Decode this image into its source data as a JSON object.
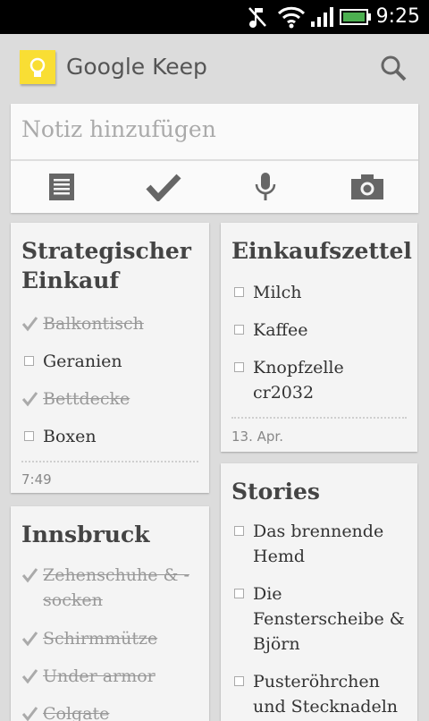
{
  "status": {
    "time": "9:25"
  },
  "app": {
    "title": "Google Keep"
  },
  "add_note": {
    "placeholder": "Notiz hinzufügen"
  },
  "notes": {
    "strategic": {
      "title_line1": "Strategischer",
      "title_line2": "Einkauf",
      "items": [
        {
          "text": "Balkontisch",
          "done": true
        },
        {
          "text": "Geranien",
          "done": false
        },
        {
          "text": "Bettdecke",
          "done": true
        },
        {
          "text": "Boxen",
          "done": false
        }
      ],
      "date": "7:49"
    },
    "shopping": {
      "title": "Einkaufszettel",
      "items": [
        {
          "text": "Milch",
          "done": false
        },
        {
          "text": "Kaffee",
          "done": false
        },
        {
          "text_line1": "Knopfzelle",
          "text_line2": "cr2032",
          "done": false
        }
      ],
      "date": "13. Apr."
    },
    "innsbruck": {
      "title": "Innsbruck",
      "items": [
        {
          "text_line1": "Zehenschuhe & -",
          "text_line2": "socken",
          "done": true
        },
        {
          "text": "Schirmmütze",
          "done": true
        },
        {
          "text": "Under armor",
          "done": true
        },
        {
          "text": "Colgate",
          "done": true
        }
      ]
    },
    "stories": {
      "title": "Stories",
      "items": [
        {
          "text_line1": "Das brennende",
          "text_line2": "Hemd",
          "done": false
        },
        {
          "text_line1": "Die",
          "text_line2": "Fensterscheibe &",
          "text_line3": "Björn",
          "done": false
        },
        {
          "text_line1": "Pusteröhrchen",
          "text_line2": "und Stecknadeln",
          "done": false
        }
      ]
    }
  },
  "colors": {
    "logo": "#f9de34",
    "background": "#dcdcdc",
    "card": "#f4f4f4"
  }
}
